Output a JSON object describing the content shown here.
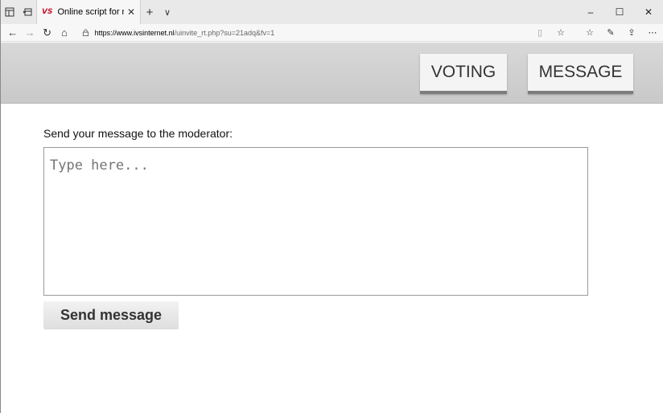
{
  "browser": {
    "tab_title": "Online script for manua",
    "tab_favicon": "VS",
    "url_host": "https://www.ivsinternet.nl",
    "url_rest": "/uinvite_rt.php?su=21adq&fv=1",
    "icons": [
      "tab-list-icon",
      "set-aside-tabs-icon",
      "new-tab-icon",
      "tab-dropdown-icon",
      "back-icon",
      "forward-icon",
      "refresh-icon",
      "home-icon",
      "lock-icon",
      "reading-view-icon",
      "favorite-star-icon",
      "favorites-hub-icon",
      "pen-icon",
      "share-icon",
      "more-icon",
      "minimize-icon",
      "maximize-icon",
      "close-icon"
    ]
  },
  "header": {
    "voting_label": "VOTING",
    "message_label": "MESSAGE"
  },
  "form": {
    "prompt": "Send your message to the moderator:",
    "placeholder": "Type here...",
    "send_label": "Send message"
  }
}
